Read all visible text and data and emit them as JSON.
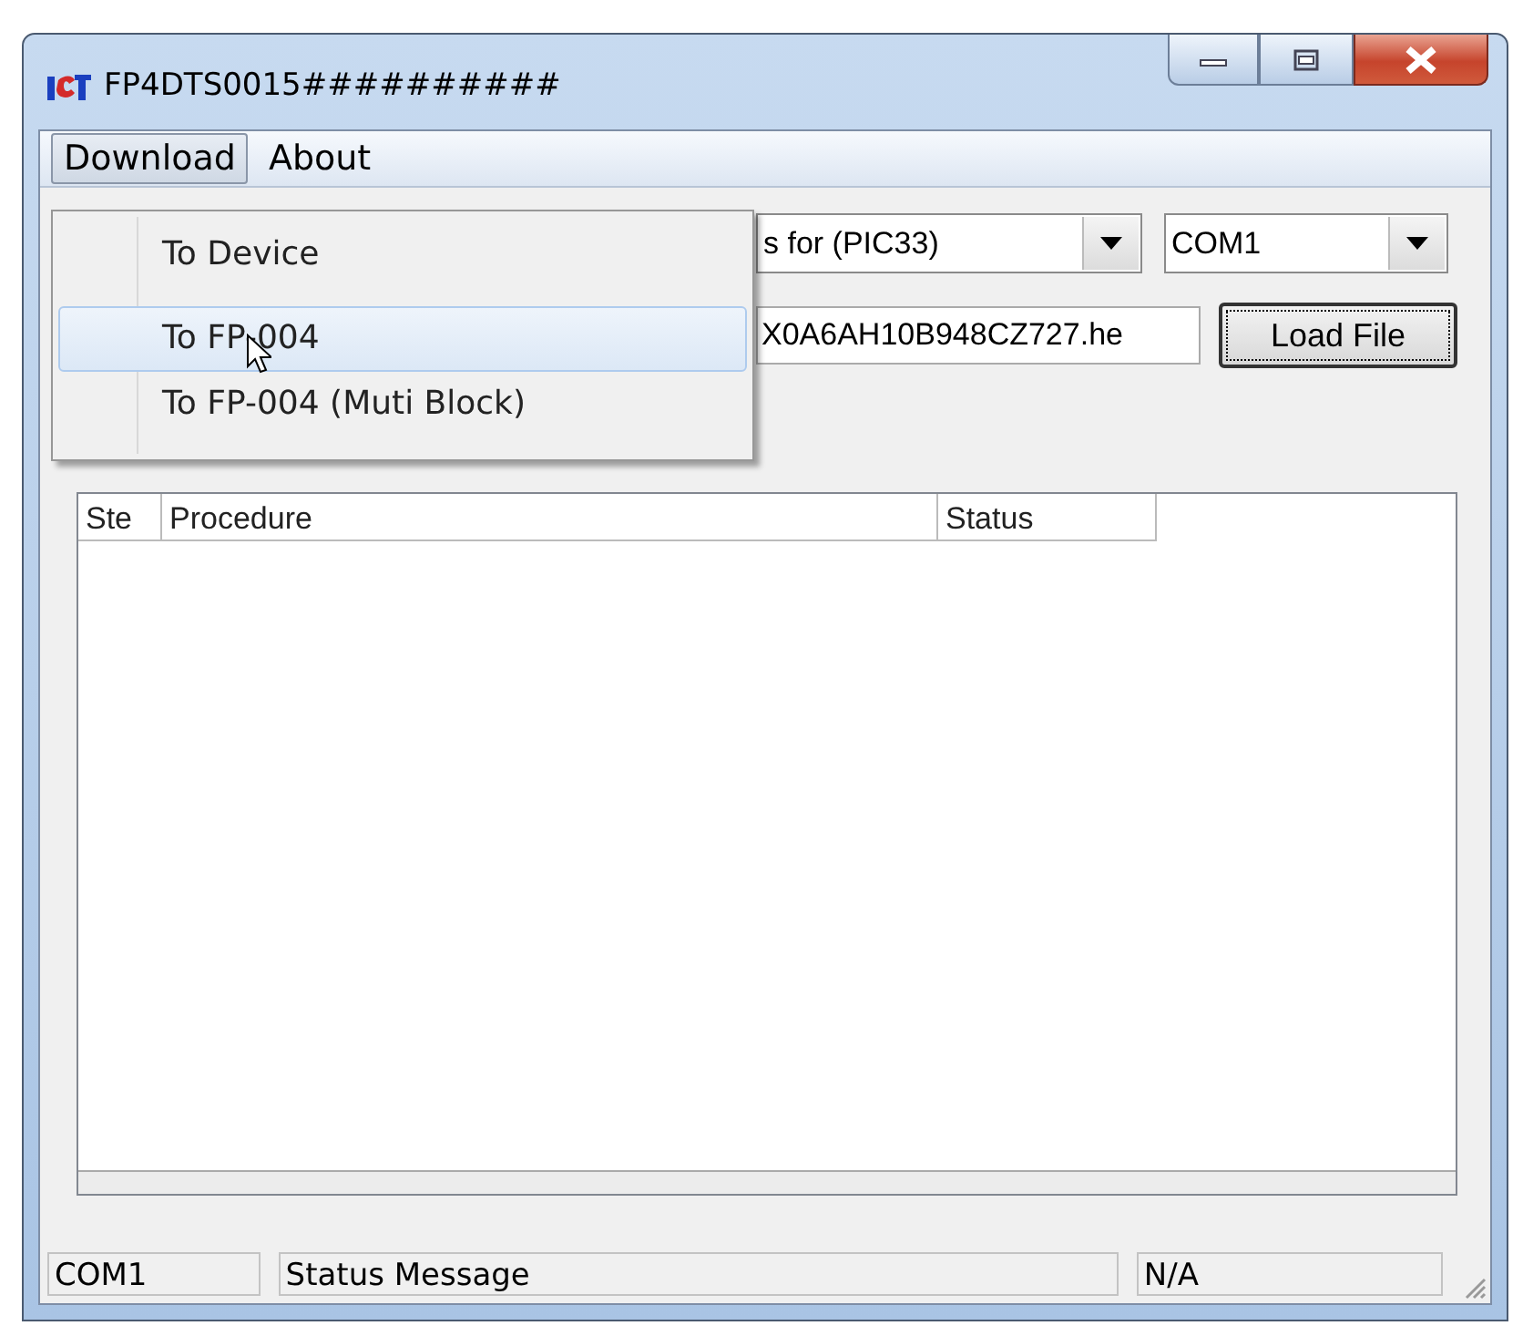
{
  "window": {
    "title": "FP4DTS0015##########"
  },
  "menu_bar": [
    {
      "label": "Download",
      "selected": true
    },
    {
      "label": "About",
      "selected": false
    }
  ],
  "dropdown_menu": [
    {
      "label": "To Device",
      "selected": false
    },
    {
      "label": "To FP-004",
      "selected": true
    },
    {
      "label": "To FP-004 (Muti Block)",
      "selected": false
    }
  ],
  "device_combo": {
    "value": "s for (PIC33)"
  },
  "port_combo": {
    "value": "COM1"
  },
  "file_field": {
    "value": "X0A6AH10B948CZ727.he"
  },
  "load_button": {
    "label": "Load File"
  },
  "table": {
    "columns": [
      "Ste",
      "Procedure",
      "Status"
    ]
  },
  "status_bar": [
    "COM1",
    "Status Message",
    "N/A"
  ]
}
